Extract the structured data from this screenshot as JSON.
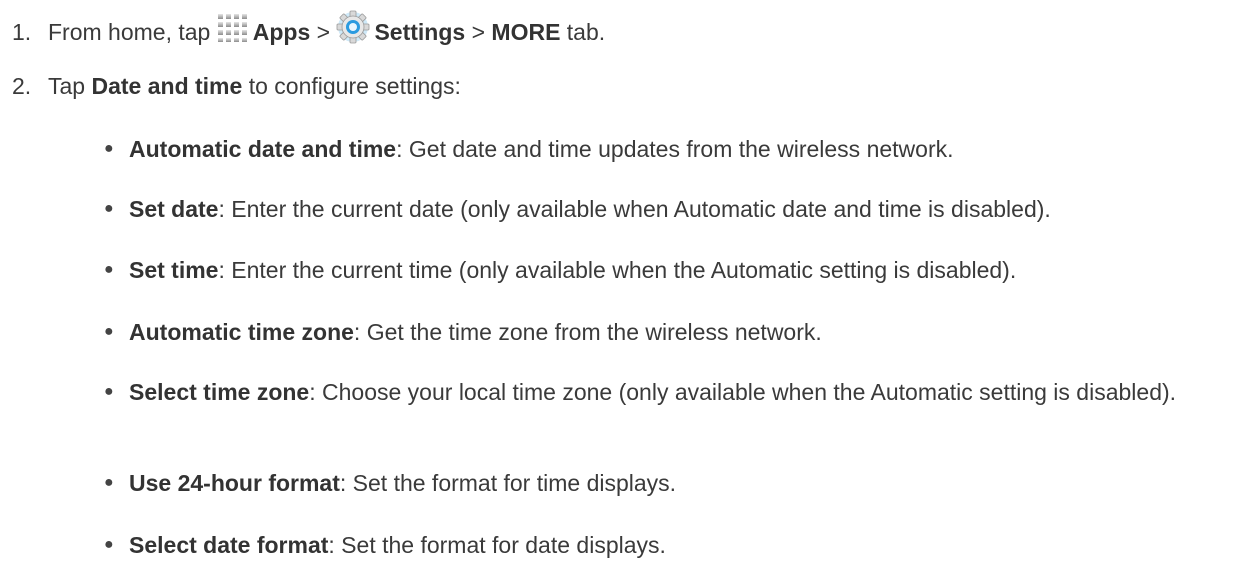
{
  "steps": [
    {
      "num": "1.",
      "prefix": "From home, tap",
      "apps_label": "Apps",
      "sep1": ">",
      "settings_label": "Settings",
      "sep2": ">",
      "more_label": "MORE",
      "suffix": "tab."
    },
    {
      "num": "2.",
      "prefix": "Tap",
      "bold": "Date and time",
      "suffix": "to configure settings:"
    }
  ],
  "bullets": [
    {
      "term": "Automatic date and time",
      "desc": ": Get date and time updates from the wireless network."
    },
    {
      "term": "Set date",
      "desc": ": Enter the current date (only available when Automatic date and time is disabled)."
    },
    {
      "term": "Set time",
      "desc": ": Enter the current time (only available when the Automatic setting is disabled)."
    },
    {
      "term": "Automatic time zone",
      "desc": ": Get the time zone from the wireless network."
    },
    {
      "term": "Select time zone",
      "desc": ": Choose your local time zone (only available when the Automatic setting is disabled)."
    },
    {
      "term": "Use 24-hour format",
      "desc": ": Set the format for time displays."
    },
    {
      "term": "Select date format",
      "desc": ": Set the format for date displays."
    }
  ],
  "bullet_glyph": "●",
  "icons": {
    "apps": "apps-grid-icon",
    "settings": "settings-gear-icon"
  },
  "colors": {
    "text": "#3a3a3a",
    "settings_icon": "#2b9be0"
  }
}
